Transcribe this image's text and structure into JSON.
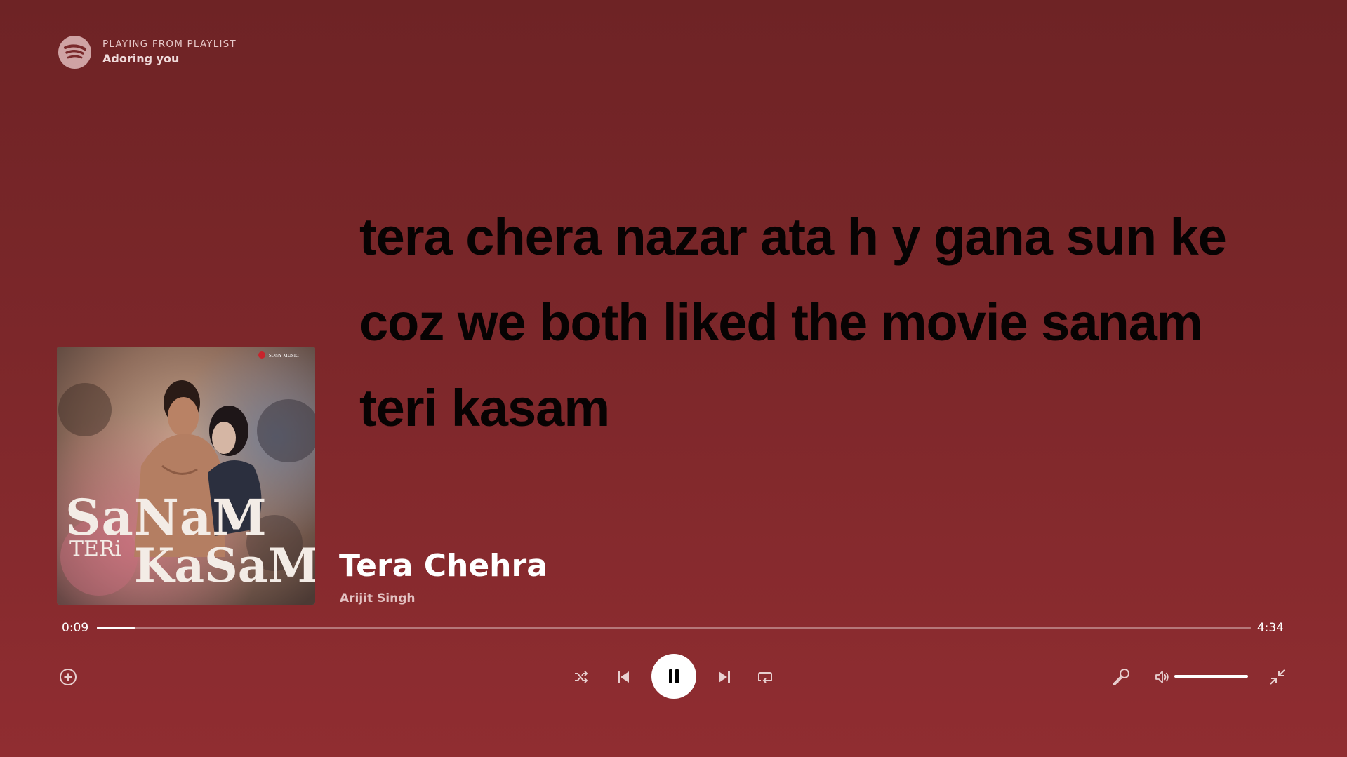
{
  "header": {
    "context_type": "PLAYING FROM PLAYLIST",
    "context_name": "Adoring you",
    "logo_icon": "spotify-logo-icon"
  },
  "lyrics": {
    "lines": [
      "tera chera nazar ata h y gana sun ke",
      "coz we both liked the movie sanam",
      "teri kasam"
    ]
  },
  "album": {
    "cover_title_line1": "SaNaM",
    "cover_title_line2a": "TERi",
    "cover_title_line2b": "KaSaM",
    "cover_label": "SONY MUSIC"
  },
  "track": {
    "title": "Tera Chehra",
    "artist": "Arijit Singh"
  },
  "playback": {
    "elapsed": "0:09",
    "duration": "4:34",
    "progress_fraction": 0.033,
    "volume_fraction": 1.0,
    "is_playing": true
  },
  "icons": {
    "add": "add-circle-icon",
    "shuffle": "shuffle-icon",
    "previous": "skip-previous-icon",
    "pause": "pause-icon",
    "next": "skip-next-icon",
    "repeat": "repeat-icon",
    "lyrics": "microphone-icon",
    "volume": "volume-icon",
    "exit_fullscreen": "exit-fullscreen-icon"
  },
  "colors": {
    "background_top": "#6e2325",
    "background_bottom": "#902d31",
    "lyrics_text": "#070303",
    "accent": "#ffffff"
  }
}
